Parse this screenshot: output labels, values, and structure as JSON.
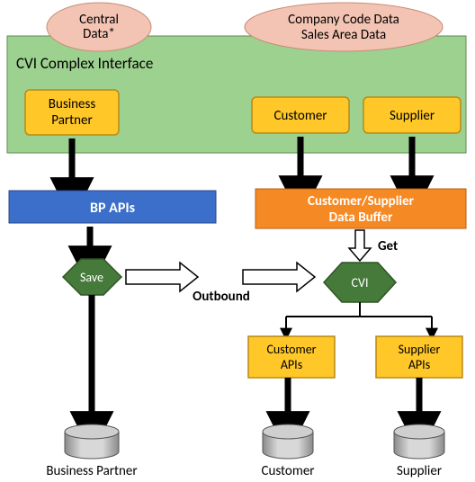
{
  "ellipses": {
    "central": {
      "line1": "Central",
      "line2": "Data*"
    },
    "company": {
      "line1": "Company Code Data",
      "line2": "Sales Area Data"
    }
  },
  "complex_interface_title": "CVI Complex Interface",
  "boxes": {
    "business_partner": "Business\nPartner",
    "customer": "Customer",
    "supplier": "Supplier",
    "bp_apis": "BP APIs",
    "cust_supp_buffer_l1": "Customer/Supplier",
    "cust_supp_buffer_l2": "Data Buffer",
    "customer_apis_l1": "Customer",
    "customer_apis_l2": "APIs",
    "supplier_apis_l1": "Supplier",
    "supplier_apis_l2": "APIs"
  },
  "hexes": {
    "save": "Save",
    "cvi": "CVI"
  },
  "labels": {
    "outbound": "Outbound",
    "get": "Get"
  },
  "db_labels": {
    "business_partner": "Business Partner",
    "customer": "Customer",
    "supplier": "Supplier"
  }
}
